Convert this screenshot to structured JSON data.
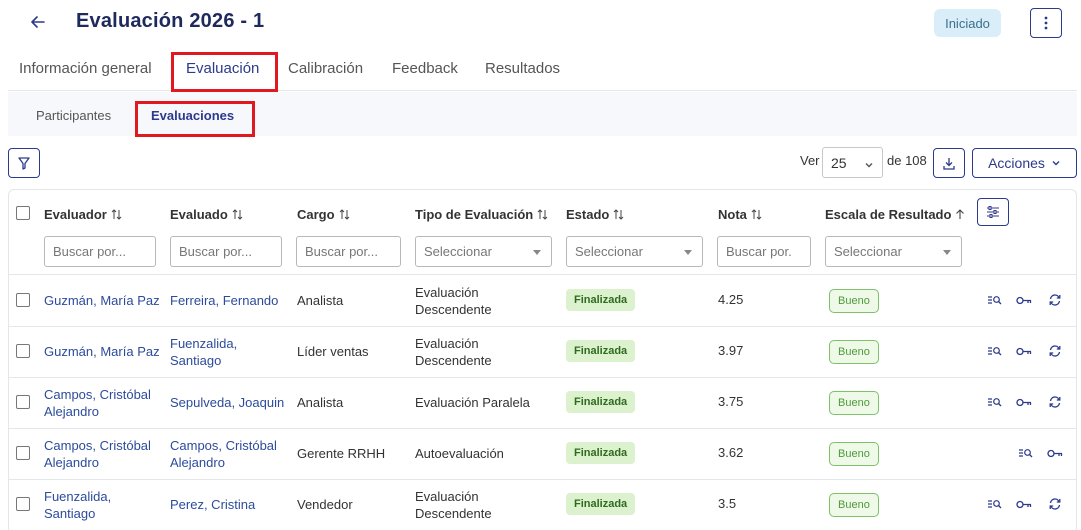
{
  "header": {
    "title": "Evaluación 2026 - 1",
    "status": "Iniciado"
  },
  "tabs": [
    {
      "label": "Información general"
    },
    {
      "label": "Evaluación"
    },
    {
      "label": "Calibración"
    },
    {
      "label": "Feedback"
    },
    {
      "label": "Resultados"
    }
  ],
  "subtabs": [
    {
      "label": "Participantes"
    },
    {
      "label": "Evaluaciones"
    }
  ],
  "toolbar": {
    "ver_label": "Ver",
    "page_size": "25",
    "of_total": "de 108",
    "actions_label": "Acciones"
  },
  "table": {
    "columns": [
      {
        "label": "Evaluador",
        "filter": "Buscar por..."
      },
      {
        "label": "Evaluado",
        "filter": "Buscar por..."
      },
      {
        "label": "Cargo",
        "filter": "Buscar por..."
      },
      {
        "label": "Tipo de Evaluación",
        "filter": "Seleccionar"
      },
      {
        "label": "Estado",
        "filter": "Seleccionar"
      },
      {
        "label": "Nota",
        "filter": "Buscar por."
      },
      {
        "label": "Escala de Resultado",
        "filter": "Seleccionar"
      }
    ],
    "rows": [
      {
        "evaluador": [
          "Guzmán, María Paz"
        ],
        "evaluado": [
          "Ferreira, Fernando"
        ],
        "cargo": "Analista",
        "tipo": [
          "Evaluación",
          "Descendente"
        ],
        "estado": "Finalizada",
        "nota": "4.25",
        "escala": "Bueno",
        "actions": [
          "view-list-icon",
          "key-icon",
          "refresh-icon"
        ]
      },
      {
        "evaluador": [
          "Guzmán, María Paz"
        ],
        "evaluado": [
          "Fuenzalida,",
          "Santiago"
        ],
        "cargo": "Líder ventas",
        "tipo": [
          "Evaluación",
          "Descendente"
        ],
        "estado": "Finalizada",
        "nota": "3.97",
        "escala": "Bueno",
        "actions": [
          "view-list-icon",
          "key-icon",
          "refresh-icon"
        ]
      },
      {
        "evaluador": [
          "Campos, Cristóbal",
          "Alejandro"
        ],
        "evaluado": [
          "Sepulveda, Joaquin"
        ],
        "cargo": "Analista",
        "tipo": [
          "Evaluación Paralela"
        ],
        "estado": "Finalizada",
        "nota": "3.75",
        "escala": "Bueno",
        "actions": [
          "view-list-icon",
          "key-icon",
          "refresh-icon"
        ]
      },
      {
        "evaluador": [
          "Campos, Cristóbal",
          "Alejandro"
        ],
        "evaluado": [
          "Campos, Cristóbal",
          "Alejandro"
        ],
        "cargo": "Gerente RRHH",
        "tipo": [
          "Autoevaluación"
        ],
        "estado": "Finalizada",
        "nota": "3.62",
        "escala": "Bueno",
        "actions": [
          "view-list-icon",
          "key-icon"
        ]
      },
      {
        "evaluador": [
          "Fuenzalida,",
          "Santiago"
        ],
        "evaluado": [
          "Perez, Cristina"
        ],
        "cargo": "Vendedor",
        "tipo": [
          "Evaluación",
          "Descendente"
        ],
        "estado": "Finalizada",
        "nota": "3.5",
        "escala": "Bueno",
        "actions": [
          "view-list-icon",
          "key-icon",
          "refresh-icon"
        ]
      }
    ]
  },
  "colors": {
    "primary": "#2c3a8c",
    "link": "#2c4b9b",
    "highlight": "#e0181f",
    "status_bg": "#d9eef8",
    "badge_green_bg": "#dcf2cf",
    "badge_green_border": "#7ec16a"
  }
}
